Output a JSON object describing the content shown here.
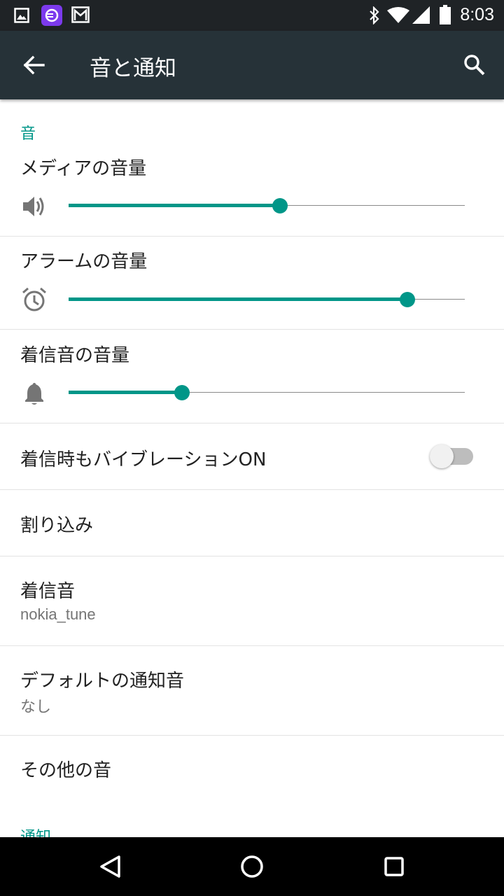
{
  "status_bar": {
    "time": "8:03",
    "left_icons": [
      "image-notification-icon",
      "app-notification-icon",
      "gmail-notification-icon"
    ],
    "right_icons": [
      "bluetooth-icon",
      "wifi-icon",
      "cell-signal-icon",
      "battery-icon"
    ]
  },
  "toolbar": {
    "title": "音と通知",
    "back_icon": "arrow-back-icon",
    "search_icon": "search-icon",
    "background": "#263238"
  },
  "sections": {
    "sound_header": "音",
    "notification_header": "通知"
  },
  "sliders": [
    {
      "title": "メディアの音量",
      "icon": "volume-icon",
      "level": 0.533
    },
    {
      "title": "アラームの音量",
      "icon": "alarm-icon",
      "level": 0.855
    },
    {
      "title": "着信音の音量",
      "icon": "bell-icon",
      "level": 0.286
    }
  ],
  "vibrate": {
    "title": "着信時もバイブレーションON",
    "checked": false
  },
  "interruptions": {
    "title": "割り込み"
  },
  "ringtone": {
    "title": "着信音",
    "summary": "nokia_tune"
  },
  "default_notification": {
    "title": "デフォルトの通知音",
    "summary": "なし"
  },
  "other_sounds": {
    "title": "その他の音"
  },
  "colors": {
    "accent": "#009688",
    "toolbar": "#263238",
    "statusbar": "#1f2326"
  },
  "navigation": [
    "back-nav-icon",
    "home-nav-icon",
    "recents-nav-icon"
  ]
}
